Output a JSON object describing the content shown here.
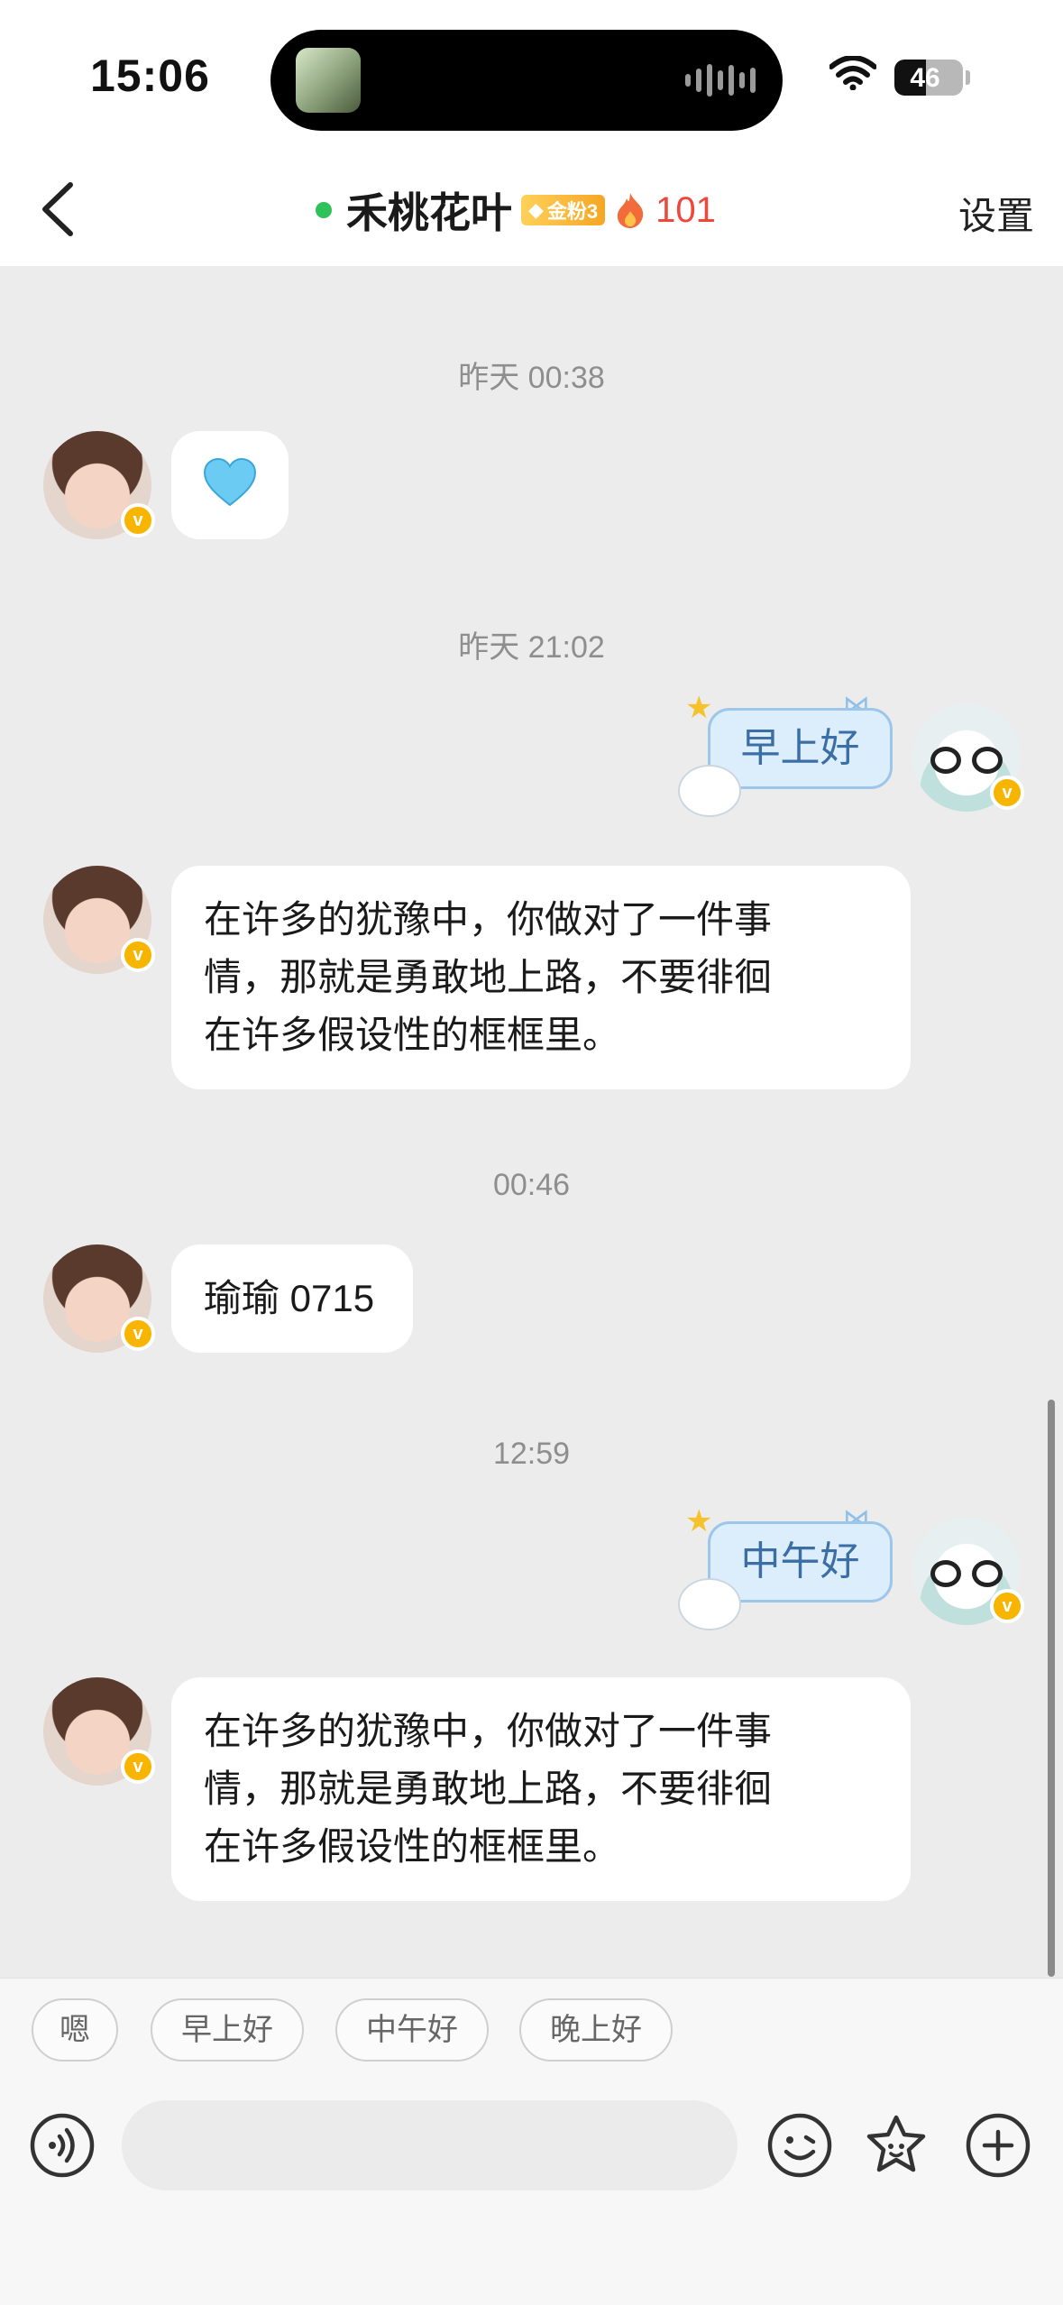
{
  "status_bar": {
    "time": "15:06",
    "battery": "46",
    "battery_level": 0.46
  },
  "header": {
    "title": "禾桃花叶",
    "fan_badge": "金粉3",
    "fire_count": "101",
    "settings_label": "设置"
  },
  "messages": [
    {
      "type": "timestamp",
      "text": "昨天 00:38"
    },
    {
      "type": "incoming",
      "kind": "emoji",
      "emoji": "💙"
    },
    {
      "type": "timestamp",
      "text": "昨天 21:02"
    },
    {
      "type": "outgoing",
      "kind": "sticker",
      "text": "早上好"
    },
    {
      "type": "incoming",
      "kind": "text",
      "lines": [
        "在许多的犹豫中，你做对了一件事",
        "情，那就是勇敢地上路，不要徘徊",
        "在许多假设性的框框里。"
      ]
    },
    {
      "type": "timestamp",
      "text": "00:46"
    },
    {
      "type": "incoming",
      "kind": "text",
      "lines": [
        "瑜瑜 0715"
      ]
    },
    {
      "type": "timestamp",
      "text": "12:59"
    },
    {
      "type": "outgoing",
      "kind": "sticker",
      "text": "中午好"
    },
    {
      "type": "incoming",
      "kind": "text",
      "lines": [
        "在许多的犹豫中，你做对了一件事",
        "情，那就是勇敢地上路，不要徘徊",
        "在许多假设性的框框里。"
      ]
    }
  ],
  "quick_replies": [
    "嗯",
    "早上好",
    "中午好",
    "晚上好"
  ],
  "input": {
    "placeholder": ""
  },
  "verified_badge": "v",
  "colors": {
    "online": "#2fc25b",
    "fire": "#f0463c",
    "badge": "#f7b500",
    "chat_bg": "#ececec"
  }
}
